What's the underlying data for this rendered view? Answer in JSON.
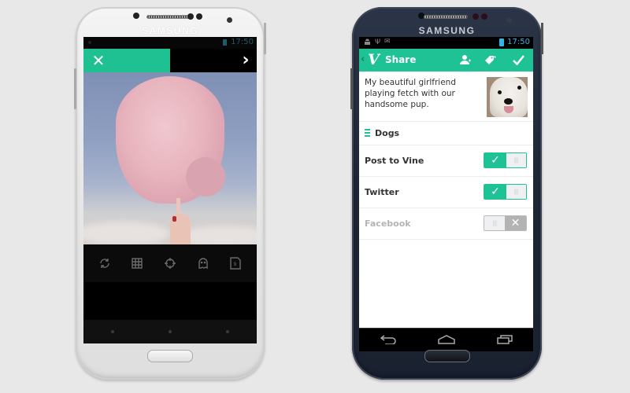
{
  "white_phone": {
    "brand": "SAMSUNG",
    "status_bar": {
      "time": "17:50"
    },
    "capture": {
      "progress_percent": 50,
      "accent_color": "#1fc092",
      "close_icon": "close-icon",
      "close_glyph": "✕",
      "next_icon": "chevron-right-icon",
      "next_glyph": "›"
    },
    "tools": [
      {
        "name": "switch-camera-icon"
      },
      {
        "name": "grid-icon"
      },
      {
        "name": "focus-icon"
      },
      {
        "name": "ghost-icon"
      },
      {
        "name": "drafts-icon",
        "badge": "9"
      }
    ]
  },
  "black_phone": {
    "brand": "SAMSUNG",
    "status_bar": {
      "time": "17:50",
      "notification_icons": [
        "android-debug-icon",
        "usb-icon",
        "mail-icon"
      ],
      "usb_glyph": "Ψ",
      "mail_glyph": "✉"
    },
    "app_bar": {
      "back_glyph": "‹",
      "logo_glyph": "V",
      "title": "Share",
      "accent_color": "#1fc294",
      "actions": [
        "add-person-icon",
        "tag-icon",
        "check-icon"
      ],
      "done_glyph": "✓"
    },
    "post": {
      "caption": "My beautiful girlfriend playing fetch with our handsome pup."
    },
    "channel": {
      "label": "Dogs"
    },
    "share_options": [
      {
        "label": "Post to Vine",
        "enabled": true,
        "on_glyph": "✓",
        "knob": "|||"
      },
      {
        "label": "Twitter",
        "enabled": true,
        "on_glyph": "✓",
        "knob": "|||"
      },
      {
        "label": "Facebook",
        "enabled": false,
        "off_glyph": "✕",
        "knob": "|||"
      }
    ],
    "nav": [
      "back-icon",
      "home-icon",
      "recent-apps-icon"
    ]
  }
}
